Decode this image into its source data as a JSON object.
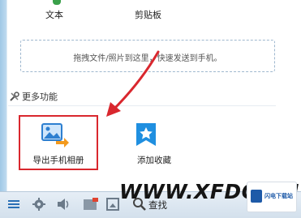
{
  "top_items": {
    "text_label": "文本",
    "clipboard_label": "剪贴板"
  },
  "dropzone": {
    "hint": "拖拽文件/照片到这里，快速发送到手机。"
  },
  "more_features": {
    "title": "更多功能",
    "tiles": [
      {
        "label": "导出手机相册",
        "icon": "photo-export-icon",
        "highlighted": true
      },
      {
        "label": "添加收藏",
        "icon": "star-bookmark-icon",
        "highlighted": false
      }
    ]
  },
  "annotation": {
    "highlight_color": "#d9272e"
  },
  "toolbar": {
    "search_label": "查找",
    "icons": [
      "menu-icon",
      "gear-icon",
      "volume-icon",
      "photo-icon",
      "screenshot-icon",
      "search-icon"
    ]
  },
  "watermark": {
    "text": "WWW.XFDOWN",
    "badge_text": "闪电下载站"
  },
  "colors": {
    "accent": "#1e7fd6",
    "toolbar_bg": "#dbe6f0"
  }
}
